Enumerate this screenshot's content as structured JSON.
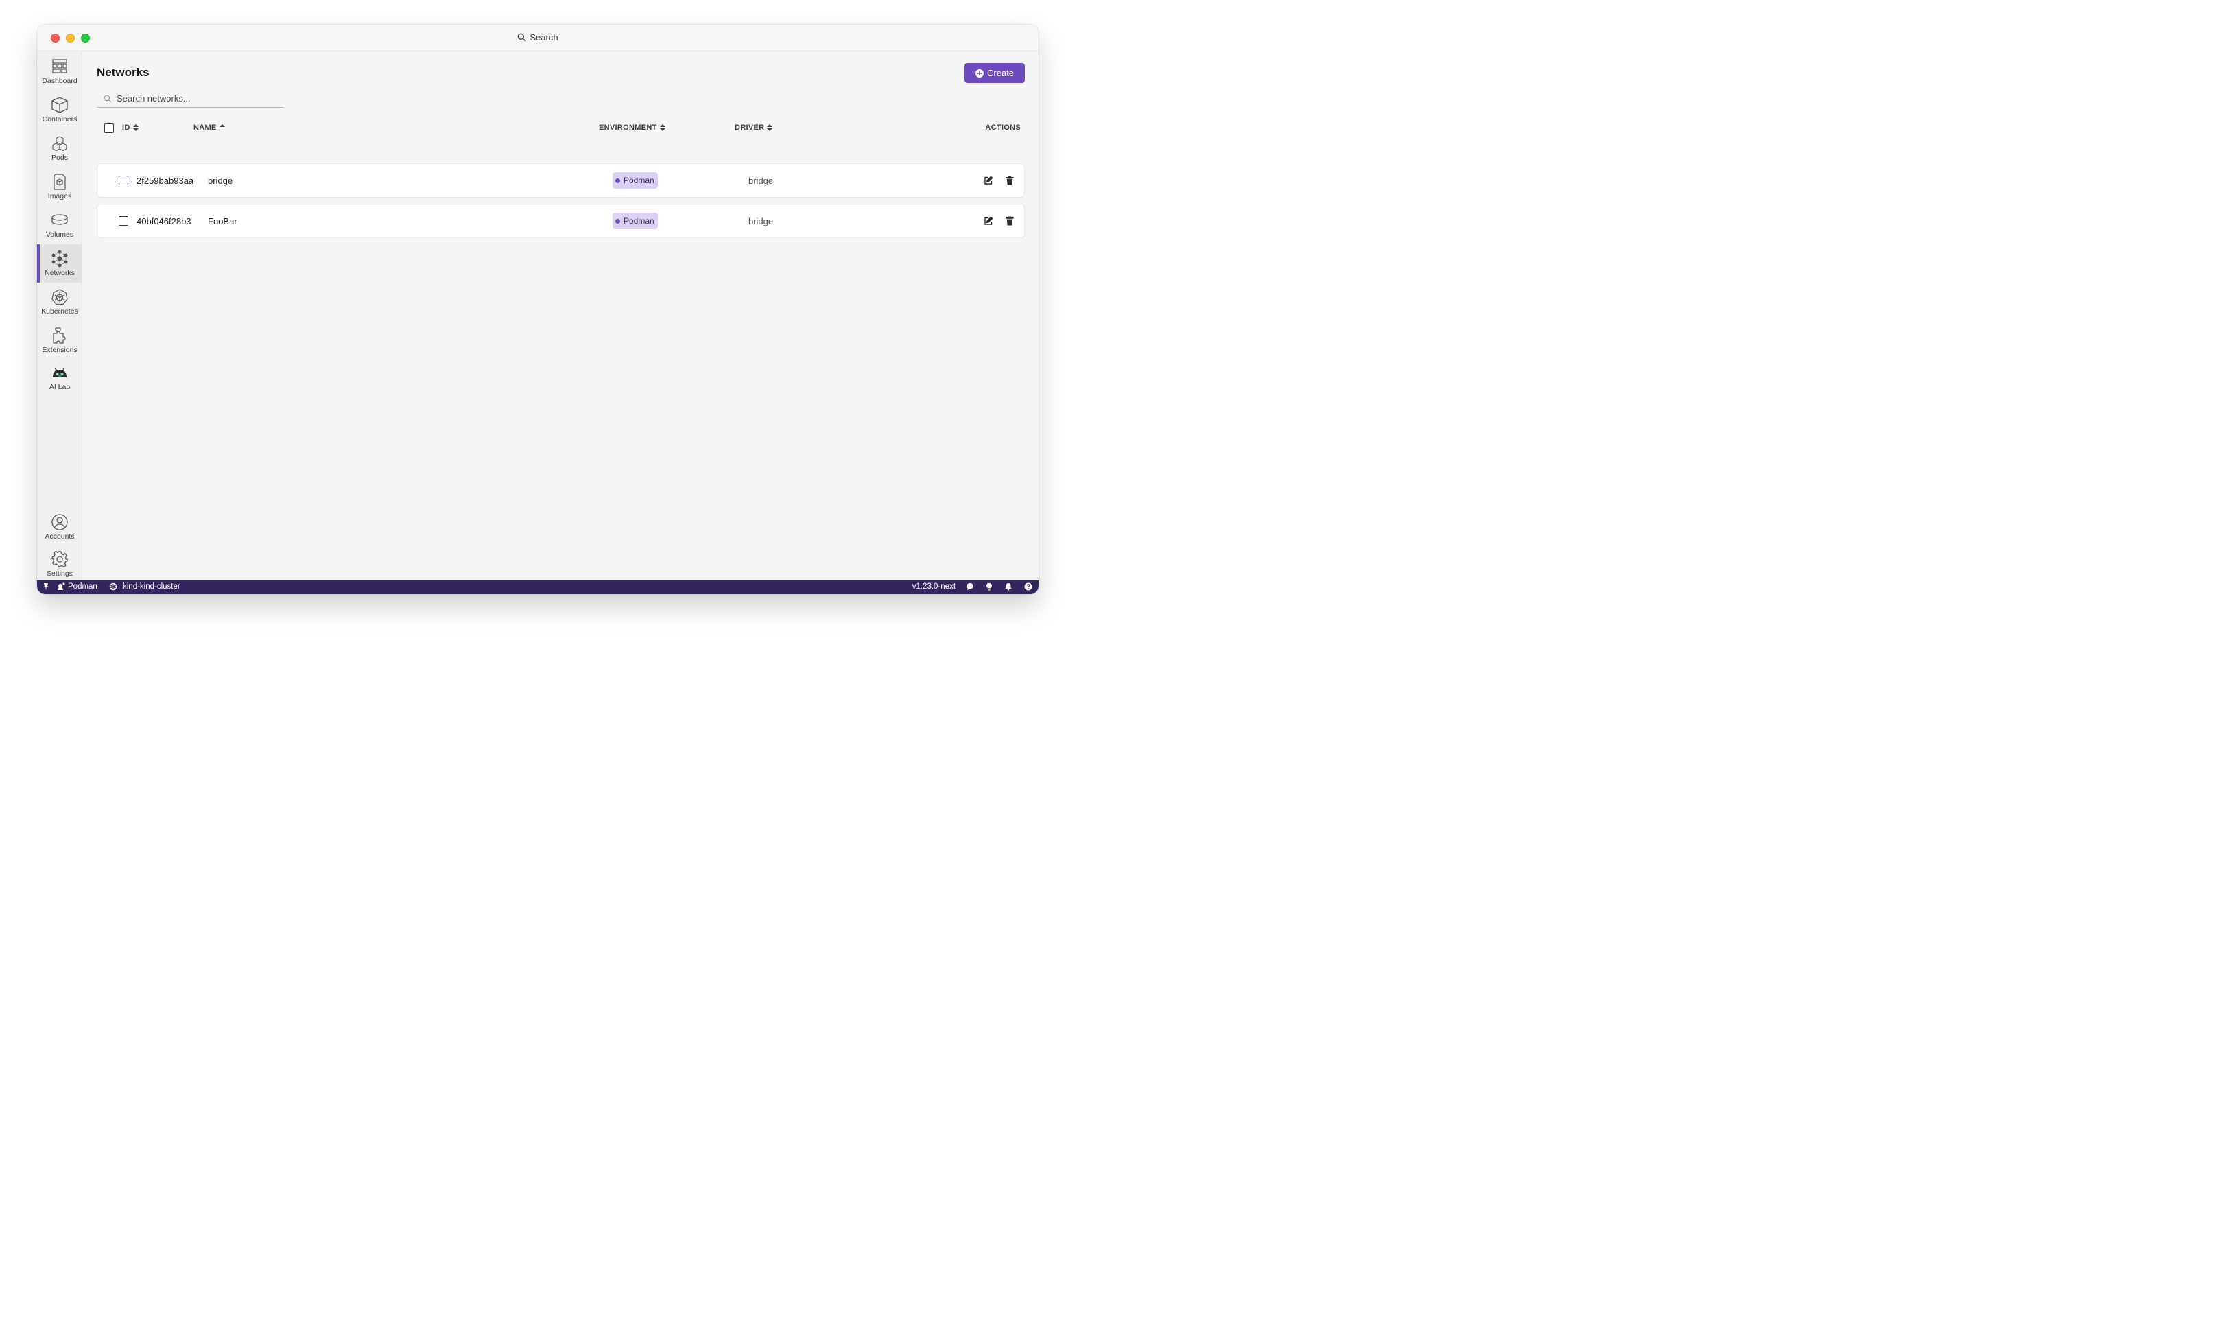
{
  "titlebar": {
    "search_label": "Search"
  },
  "sidebar": {
    "items": [
      {
        "label": "Dashboard",
        "icon": "dashboard-icon"
      },
      {
        "label": "Containers",
        "icon": "box-icon"
      },
      {
        "label": "Pods",
        "icon": "pods-icon"
      },
      {
        "label": "Images",
        "icon": "image-icon"
      },
      {
        "label": "Volumes",
        "icon": "volume-icon"
      },
      {
        "label": "Networks",
        "icon": "network-icon",
        "active": true
      },
      {
        "label": "Kubernetes",
        "icon": "kubernetes-icon"
      },
      {
        "label": "Extensions",
        "icon": "puzzle-icon"
      },
      {
        "label": "AI Lab",
        "icon": "ai-lab-icon"
      }
    ],
    "bottom": [
      {
        "label": "Accounts",
        "icon": "account-icon"
      },
      {
        "label": "Settings",
        "icon": "gear-icon"
      }
    ]
  },
  "page": {
    "title": "Networks",
    "create_label": "Create",
    "search_placeholder": "Search networks..."
  },
  "table": {
    "columns": {
      "id": "ID",
      "name": "NAME",
      "environment": "ENVIRONMENT",
      "driver": "DRIVER",
      "actions": "ACTIONS"
    },
    "rows": [
      {
        "id": "2f259bab93aa",
        "name": "bridge",
        "environment": "Podman",
        "driver": "bridge"
      },
      {
        "id": "40bf046f28b3",
        "name": "FooBar",
        "environment": "Podman",
        "driver": "bridge"
      }
    ]
  },
  "statusbar": {
    "engine": "Podman",
    "context": "kind-kind-cluster",
    "version": "v1.23.0-next"
  },
  "colors": {
    "accent": "#6d48bf",
    "statusbar_bg": "#33255e",
    "badge_bg": "#ddd0f7"
  }
}
